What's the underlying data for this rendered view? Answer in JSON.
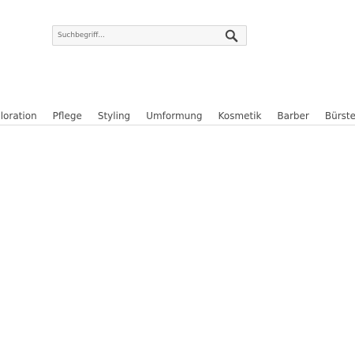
{
  "search": {
    "placeholder": "Suchbegriff...",
    "icon": "search-icon"
  },
  "nav": {
    "items": [
      "Coloration",
      "Pflege",
      "Styling",
      "Umformung",
      "Kosmetik",
      "Barber",
      "Bürsten"
    ]
  }
}
